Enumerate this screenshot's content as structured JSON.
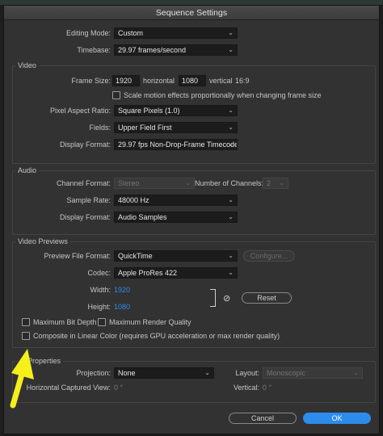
{
  "title": "Sequence Settings",
  "general": {
    "editing_mode_label": "Editing Mode:",
    "editing_mode_value": "Custom",
    "timebase_label": "Timebase:",
    "timebase_value": "29.97  frames/second"
  },
  "video": {
    "section_title": "Video",
    "frame_size_label": "Frame Size:",
    "frame_width": "1920",
    "horizontal_label": "horizontal",
    "frame_height": "1080",
    "vertical_label": "vertical",
    "aspect": "16:9",
    "scale_motion_label": "Scale motion effects proportionally when changing frame size",
    "pixel_aspect_label": "Pixel Aspect Ratio:",
    "pixel_aspect_value": "Square Pixels (1.0)",
    "fields_label": "Fields:",
    "fields_value": "Upper Field First",
    "display_format_label": "Display Format:",
    "display_format_value": "29.97 fps Non-Drop-Frame Timecode"
  },
  "audio": {
    "section_title": "Audio",
    "channel_format_label": "Channel Format:",
    "channel_format_value": "Stereo",
    "num_channels_label": "Number of Channels:",
    "num_channels_value": "2",
    "sample_rate_label": "Sample Rate:",
    "sample_rate_value": "48000 Hz",
    "display_format_label": "Display Format:",
    "display_format_value": "Audio Samples"
  },
  "previews": {
    "section_title": "Video Previews",
    "file_format_label": "Preview File Format:",
    "file_format_value": "QuickTime",
    "configure_label": "Configure...",
    "codec_label": "Codec:",
    "codec_value": "Apple ProRes 422",
    "width_label": "Width:",
    "width_value": "1920",
    "height_label": "Height:",
    "height_value": "1080",
    "reset_label": "Reset"
  },
  "options": {
    "max_bit_depth": "Maximum Bit Depth",
    "max_render_quality": "Maximum Render Quality",
    "composite_linear": "Composite in Linear Color (requires GPU acceleration or max render quality)"
  },
  "vr": {
    "section_title": "Properties",
    "projection_label": "Projection:",
    "projection_value": "None",
    "layout_label": "Layout:",
    "layout_value": "Monoscopic",
    "h_view_label": "Horizontal Captured View:",
    "h_view_value": "0 °",
    "vertical_label": "Vertical:",
    "vertical_value": "0 °"
  },
  "buttons": {
    "cancel": "Cancel",
    "ok": "OK"
  },
  "colors": {
    "dialog_bg": "#323232",
    "accent_blue": "#2d8ceb",
    "annotation_arrow": "#f5ef1a"
  }
}
